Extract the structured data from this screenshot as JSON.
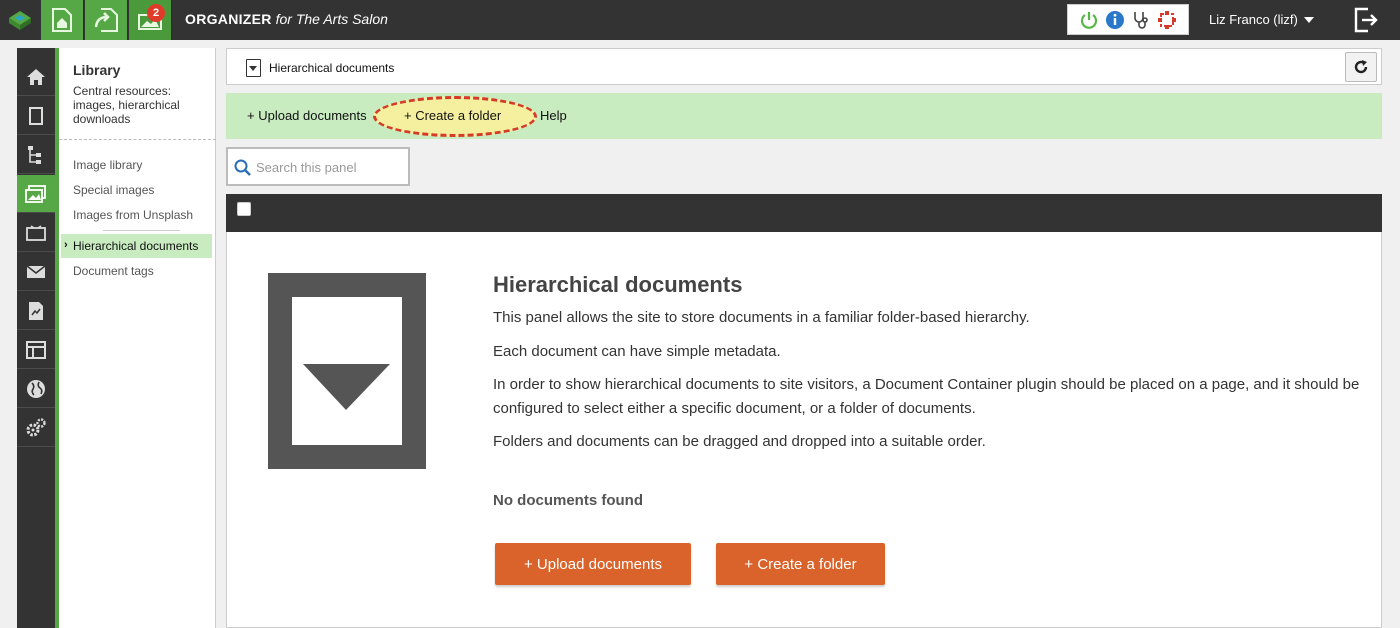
{
  "topbar": {
    "brand_bold": "ORGANIZER",
    "brand_rest": " for The Arts Salon",
    "notifications_count": "2",
    "user_label": "Liz Franco (lizf)",
    "accent_green": "#56a846",
    "badge_red": "#e03b2a",
    "status_icons": [
      "power-icon",
      "info-icon",
      "stethoscope-icon",
      "lifebuoy-icon"
    ]
  },
  "rail": {
    "icons": [
      "home-icon",
      "page-icon",
      "hierarchy-icon",
      "images-icon",
      "video-icon",
      "mail-icon",
      "document-icon",
      "form-icon",
      "globe-icon",
      "gears-icon"
    ],
    "active_index": 3
  },
  "library": {
    "title": "Library",
    "description": "Central resources: images, hierarchical downloads",
    "items": [
      {
        "label": "Image library"
      },
      {
        "label": "Special images"
      },
      {
        "label": "Images from Unsplash"
      },
      {
        "label": "Hierarchical documents"
      },
      {
        "label": "Document tags"
      }
    ],
    "active_index": 3
  },
  "header": {
    "title": "Hierarchical documents"
  },
  "actions": {
    "upload": "+ Upload documents",
    "create": "+ Create a folder",
    "help": "Help"
  },
  "search": {
    "placeholder": "Search this panel"
  },
  "content": {
    "title": "Hierarchical documents",
    "paragraphs": [
      "This panel allows the site to store documents in a familiar folder-based hierarchy.",
      "Each document can have simple metadata.",
      "In order to show hierarchical documents to site visitors, a Document Container plugin should be placed on a page, and it should be configured to select either a specific document, or a folder of documents.",
      "Folders and documents can be dragged and dropped into a suitable order."
    ],
    "empty_text": "No documents found",
    "upload_button": "+ Upload documents",
    "create_button": "+ Create a folder",
    "button_color": "#d9632a"
  }
}
